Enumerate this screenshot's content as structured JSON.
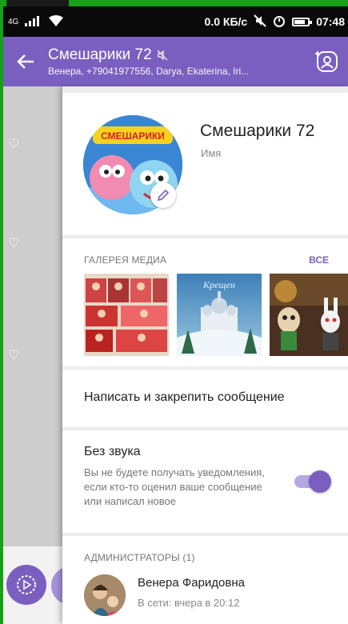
{
  "status_bar": {
    "network": "4G",
    "speed": "0.0 КБ/с",
    "time": "07:48"
  },
  "header": {
    "title": "Смешарики 72",
    "subtitle": "Венера, +79041977556, Darya, Ekaterina, Iri..."
  },
  "profile": {
    "name": "Смешарики 72",
    "name_label": "Имя",
    "avatar_logo": "СМЕШАРИКИ"
  },
  "gallery": {
    "title": "ГАЛЕРЕЯ МЕДИА",
    "all_label": "ВСЕ",
    "thumb2_caption": "Крещен"
  },
  "pin": {
    "label": "Написать и закрепить сообщение"
  },
  "mute": {
    "title": "Без звука",
    "description": "Вы не будете получать уведомления, если кто-то оценил ваше сообщение или написал новое",
    "enabled": true
  },
  "admins": {
    "title": "АДМИНИСТРАТОРЫ (1)",
    "items": [
      {
        "name": "Венера Фаридовна",
        "status": "В сети: вчера в 20:12"
      }
    ]
  },
  "colors": {
    "accent": "#7a5fc0",
    "green_frame": "#18a018"
  },
  "icons": [
    "back-arrow-icon",
    "mute-icon",
    "add-participant-icon",
    "pencil-icon",
    "play-icon",
    "heart-icon",
    "signal-icon",
    "wifi-icon",
    "battery-icon",
    "alarm-icon"
  ]
}
